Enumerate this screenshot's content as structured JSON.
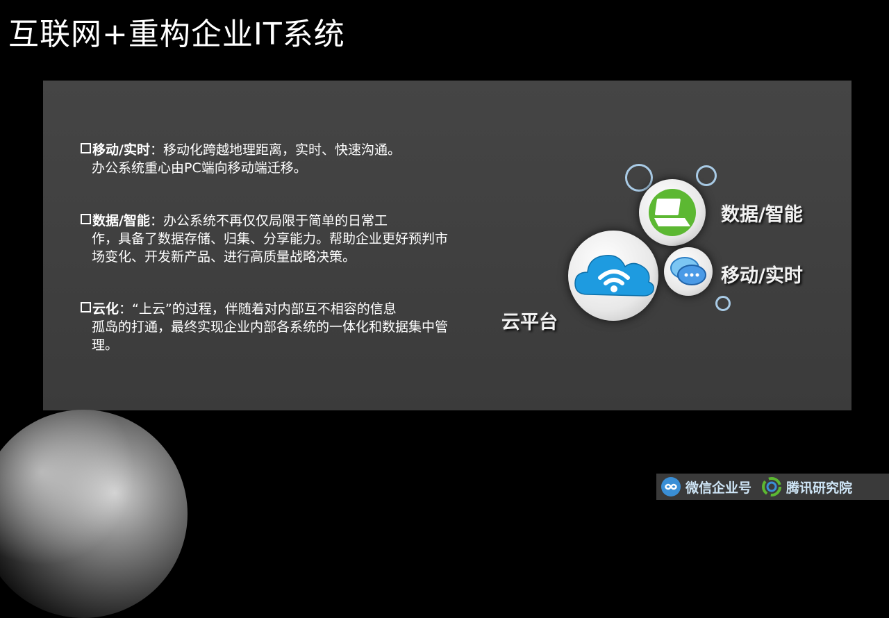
{
  "slide": {
    "title": "互联网+重构企业IT系统"
  },
  "bullets": [
    {
      "head": "移动/实时",
      "sep": "：",
      "first_line": "移动化跨越地理距离，实时、快速沟通。",
      "rest": "办公系统重心由PC端向移动端迁移。"
    },
    {
      "head": "数据/智能",
      "sep": "：",
      "first_line": "办公系统不再仅仅局限于简单的日常工",
      "rest": "作，具备了数据存储、归集、分享能力。帮助企业更好预判市场变化、开发新产品、进行高质量战略决策。"
    },
    {
      "head": "云化",
      "sep": "：",
      "first_line": "“上云”的过程，伴随着对内部互不相容的信息",
      "rest": "孤岛的打通，最终实现企业内部各系统的一体化和数据集中管理。"
    }
  ],
  "diagram": {
    "cloud_label": "云平台",
    "data_label": "数据/智能",
    "mobile_label": "移动/实时",
    "icons": [
      "cloud-wifi-icon",
      "laptop-icon",
      "chat-bubble-icon"
    ],
    "colors": {
      "cloud": "#1e9be0",
      "laptop": "#5cb832",
      "chat": "#4a9ae6",
      "ring": "#a9cbe6"
    }
  },
  "footer": {
    "wechat_label": "微信企业号",
    "tencent_label": "腾讯研究院"
  }
}
